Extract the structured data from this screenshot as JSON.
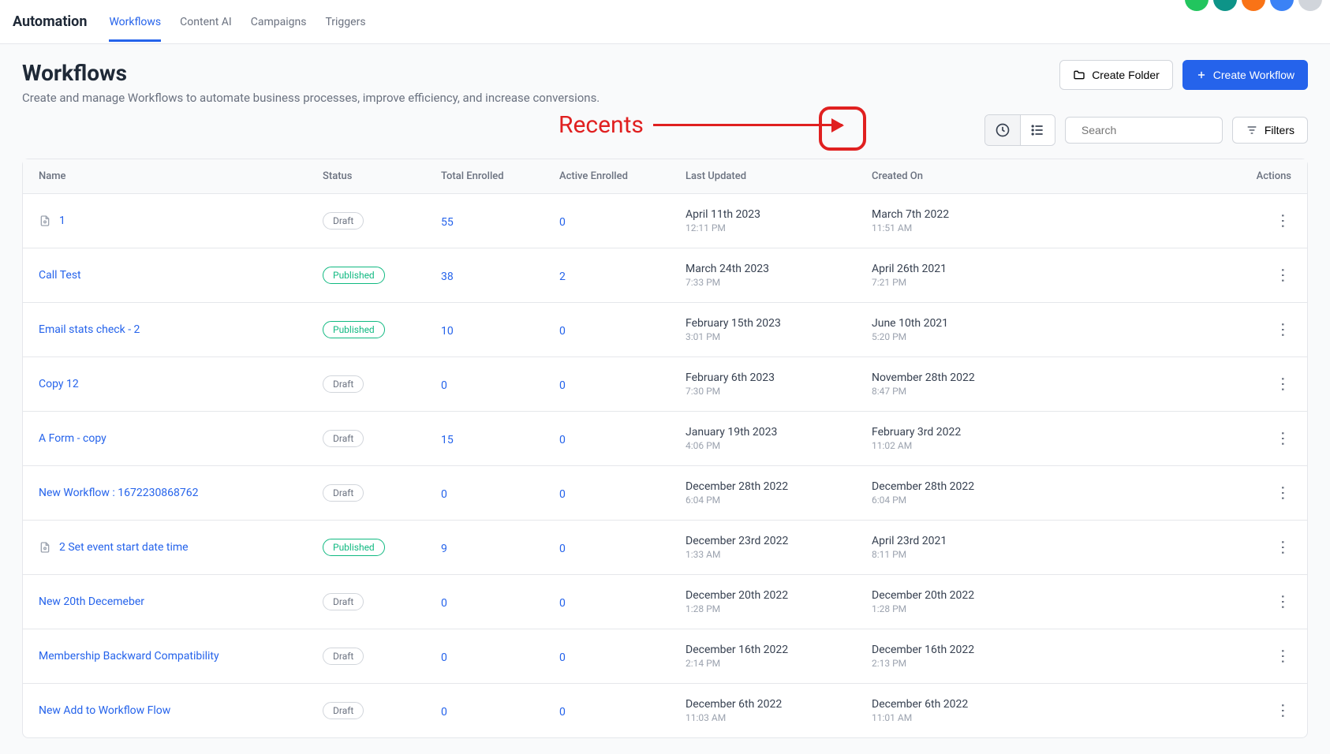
{
  "nav": {
    "app": "Automation",
    "tabs": [
      "Workflows",
      "Content AI",
      "Campaigns",
      "Triggers"
    ],
    "activeTab": 0,
    "circleColors": [
      "#22c55e",
      "#0d9488",
      "#f97316",
      "#3b82f6",
      "#d1d5db"
    ]
  },
  "header": {
    "title": "Workflows",
    "subtitle": "Create and manage Workflows to automate business processes, improve efficiency, and increase conversions.",
    "createFolder": "Create Folder",
    "createWorkflow": "Create Workflow"
  },
  "toolbar": {
    "searchPlaceholder": "Search",
    "filters": "Filters",
    "annotation": "Recents"
  },
  "table": {
    "columns": [
      "Name",
      "Status",
      "Total Enrolled",
      "Active Enrolled",
      "Last Updated",
      "Created On",
      "Actions"
    ],
    "rows": [
      {
        "name": "1",
        "hasIcon": true,
        "status": "Draft",
        "total": "55",
        "active": "0",
        "updatedDate": "April 11th 2023",
        "updatedTime": "12:11 PM",
        "createdDate": "March 7th 2022",
        "createdTime": "11:51 AM"
      },
      {
        "name": "Call Test",
        "hasIcon": false,
        "status": "Published",
        "total": "38",
        "active": "2",
        "updatedDate": "March 24th 2023",
        "updatedTime": "7:33 PM",
        "createdDate": "April 26th 2021",
        "createdTime": "7:21 PM"
      },
      {
        "name": "Email stats check - 2",
        "hasIcon": false,
        "status": "Published",
        "total": "10",
        "active": "0",
        "updatedDate": "February 15th 2023",
        "updatedTime": "3:01 PM",
        "createdDate": "June 10th 2021",
        "createdTime": "5:20 PM"
      },
      {
        "name": "Copy 12",
        "hasIcon": false,
        "status": "Draft",
        "total": "0",
        "active": "0",
        "updatedDate": "February 6th 2023",
        "updatedTime": "7:30 PM",
        "createdDate": "November 28th 2022",
        "createdTime": "8:47 PM"
      },
      {
        "name": "A Form - copy",
        "hasIcon": false,
        "status": "Draft",
        "total": "15",
        "active": "0",
        "updatedDate": "January 19th 2023",
        "updatedTime": "4:06 PM",
        "createdDate": "February 3rd 2022",
        "createdTime": "11:02 AM"
      },
      {
        "name": "New Workflow : 1672230868762",
        "hasIcon": false,
        "status": "Draft",
        "total": "0",
        "active": "0",
        "updatedDate": "December 28th 2022",
        "updatedTime": "6:04 PM",
        "createdDate": "December 28th 2022",
        "createdTime": "6:04 PM"
      },
      {
        "name": "2 Set event start date time",
        "hasIcon": true,
        "status": "Published",
        "total": "9",
        "active": "0",
        "updatedDate": "December 23rd 2022",
        "updatedTime": "1:33 AM",
        "createdDate": "April 23rd 2021",
        "createdTime": "8:11 PM"
      },
      {
        "name": "New 20th Decemeber",
        "hasIcon": false,
        "status": "Draft",
        "total": "0",
        "active": "0",
        "updatedDate": "December 20th 2022",
        "updatedTime": "1:28 PM",
        "createdDate": "December 20th 2022",
        "createdTime": "1:28 PM"
      },
      {
        "name": "Membership Backward Compatibility",
        "hasIcon": false,
        "status": "Draft",
        "total": "0",
        "active": "0",
        "updatedDate": "December 16th 2022",
        "updatedTime": "2:14 PM",
        "createdDate": "December 16th 2022",
        "createdTime": "2:13 PM"
      },
      {
        "name": "New Add to Workflow Flow",
        "hasIcon": false,
        "status": "Draft",
        "total": "0",
        "active": "0",
        "updatedDate": "December 6th 2022",
        "updatedTime": "11:03 AM",
        "createdDate": "December 6th 2022",
        "createdTime": "11:01 AM"
      }
    ]
  }
}
